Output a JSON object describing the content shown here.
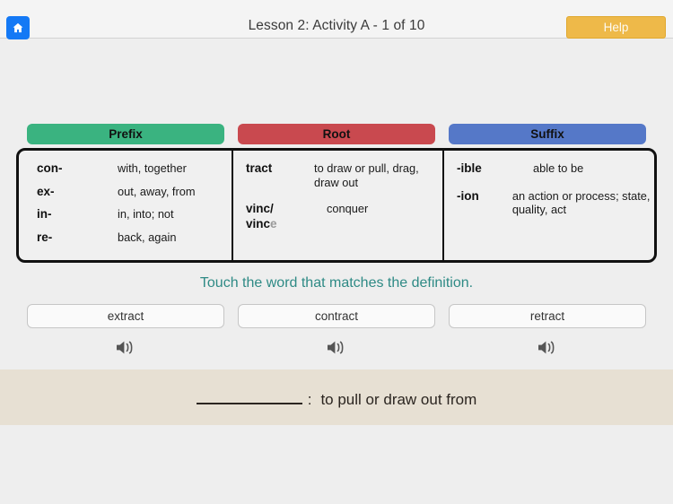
{
  "header": {
    "home_icon": "home-icon",
    "title": "Lesson 2:  Activity A - 1 of 10",
    "help_label": "Help",
    "help_color": "#eeb949",
    "home_color": "#1479f5"
  },
  "chart": {
    "columns": [
      {
        "heading": "Prefix",
        "color": "#3ab380",
        "entries": [
          {
            "key": "con-",
            "value": "with, together"
          },
          {
            "key": "ex-",
            "value": "out, away, from"
          },
          {
            "key": "in-",
            "value": "in, into; not"
          },
          {
            "key": "re-",
            "value": "back, again"
          }
        ]
      },
      {
        "heading": "Root",
        "color": "#c9494f",
        "entries": [
          {
            "key": "tract",
            "value": "to draw or pull, drag, draw out"
          },
          {
            "key": "vinc/",
            "key_line2": "vinc",
            "key_line2_faded": "e",
            "value": "conquer"
          }
        ]
      },
      {
        "heading": "Suffix",
        "color": "#5578c8",
        "entries": [
          {
            "key": "-ible",
            "value": "able to be"
          },
          {
            "key": "-ion",
            "value": "an action or process; state, quality, act"
          }
        ]
      }
    ]
  },
  "instruction": {
    "text": "Touch the word that matches the definition.",
    "color": "#2e8a85"
  },
  "choices": [
    {
      "label": "extract",
      "speaker_icon": "speaker-icon"
    },
    {
      "label": "contract",
      "speaker_icon": "speaker-icon"
    },
    {
      "label": "retract",
      "speaker_icon": "speaker-icon"
    }
  ],
  "definition": {
    "blank": "",
    "colon": ":",
    "text": "to pull or draw out from",
    "band_color": "#e7e0d3"
  }
}
